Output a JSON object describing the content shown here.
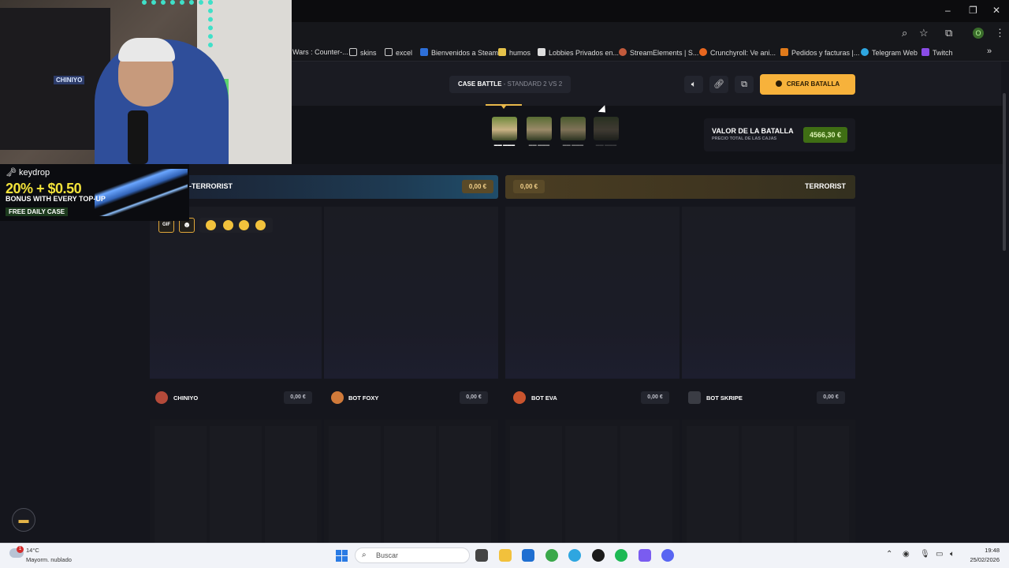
{
  "browser": {
    "bookmarks": [
      {
        "label": "Wars : Counter-..."
      },
      {
        "label": "skins"
      },
      {
        "label": "excel"
      },
      {
        "label": "Bienvenidos a Steam"
      },
      {
        "label": "humos"
      },
      {
        "label": "Lobbies Privados en..."
      },
      {
        "label": "StreamElements | S..."
      },
      {
        "label": "Crunchyroll: Ve ani..."
      },
      {
        "label": "Pedidos y facturas |..."
      },
      {
        "label": "Telegram Web"
      },
      {
        "label": "Twitch"
      }
    ],
    "profile_initial": "O",
    "window_controls": [
      "–",
      "❐",
      "✕"
    ]
  },
  "webcam": {
    "shelf_label": "CHINIYO"
  },
  "keydrop": {
    "logo": "keydrop",
    "headline": "20% + $0.50",
    "subline": "BONUS WITH EVERY TOP-UP",
    "daily": "FREE DAILY CASE"
  },
  "header": {
    "mode_label": "CASE BATTLE",
    "mode_detail": "- STANDARD 2 VS 2",
    "create_label": "CREAR BATALLA",
    "accent": "#f7b23b"
  },
  "cases": [
    {
      "label": "▬▬ ▬▬▬",
      "active": true
    },
    {
      "label": "▬▬ ▬▬▬",
      "active": false
    },
    {
      "label": "▬▬ ▬▬▬",
      "active": false
    },
    {
      "label": "▬▬ ▬▬▬",
      "active": false
    }
  ],
  "battle_value": {
    "title": "VALOR DE LA BATALLA",
    "subtitle": "PRECIO TOTAL DE LAS CAJAS",
    "value": "4566,30 €"
  },
  "teams": {
    "ct": {
      "name": "-TERRORIST",
      "value": "0,00 €"
    },
    "t": {
      "name": "TERRORIST",
      "value": "0,00 €"
    }
  },
  "emotes": {
    "gif_label": "GIF"
  },
  "players": [
    {
      "name": "CHINIYO",
      "value": "0,00 €",
      "avatar_color": "#b44a3a"
    },
    {
      "name": "BOT FOXY",
      "value": "0,00 €",
      "avatar_color": "#d07a3a"
    },
    {
      "name": "BOT EVA",
      "value": "0,00 €",
      "avatar_color": "#c9542e"
    },
    {
      "name": "BOT SKRIPE",
      "value": "0,00 €",
      "avatar_color": "#3a3c44"
    }
  ],
  "taskbar": {
    "weather_temp": "14°C",
    "weather_desc": "Mayorm. nublado",
    "weather_badge": "1",
    "search_placeholder": "Buscar",
    "time": "19:48",
    "date": "25/02/2026"
  }
}
